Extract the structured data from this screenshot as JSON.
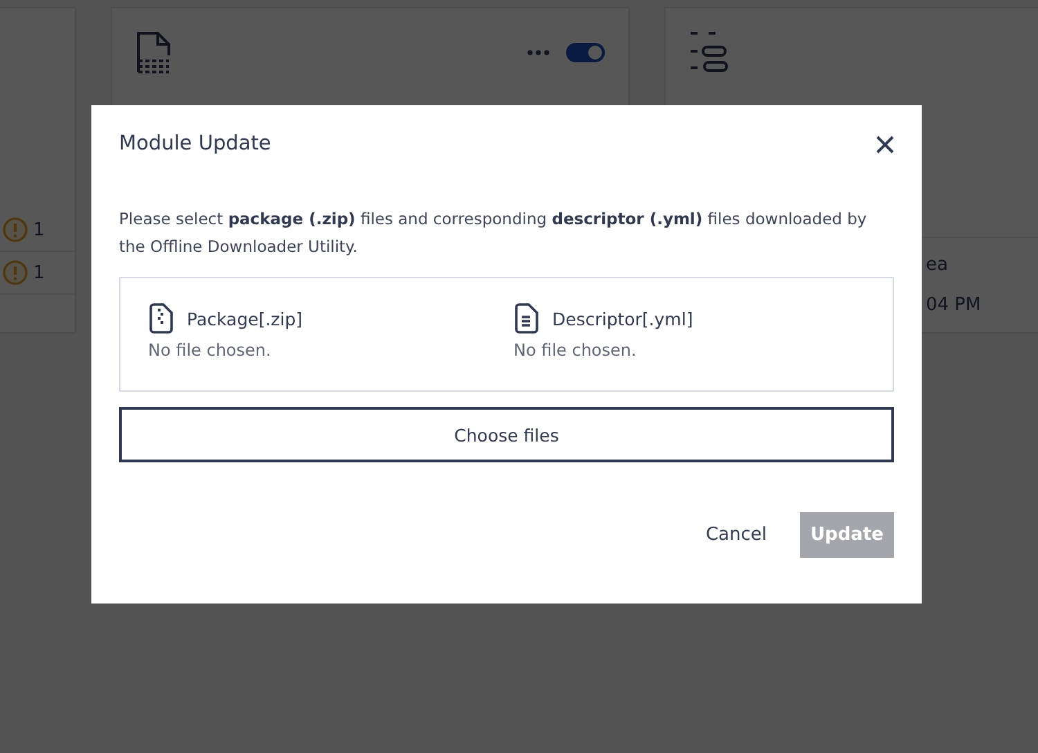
{
  "background": {
    "cards": [
      {
        "kind": "partial",
        "counts": [
          "1",
          "1"
        ]
      },
      {
        "kind": "module",
        "toggle": {
          "on": true
        }
      },
      {
        "kind": "module",
        "lines": [
          "ea",
          "04 PM"
        ]
      }
    ]
  },
  "dialog": {
    "title": "Module Update",
    "description": "Please select **package (.zip)** files and corresponding **descriptor (.yml)** files downloaded by the Offline Downloader Utility.",
    "files": [
      {
        "kind": "zip",
        "label": "Package[.zip]",
        "status": "No file chosen."
      },
      {
        "kind": "doc",
        "label": "Descriptor[.yml]",
        "status": "No file chosen."
      }
    ],
    "choose_button": "Choose files",
    "cancel_button": "Cancel",
    "update_button": {
      "label": "Update",
      "disabled": true
    }
  }
}
